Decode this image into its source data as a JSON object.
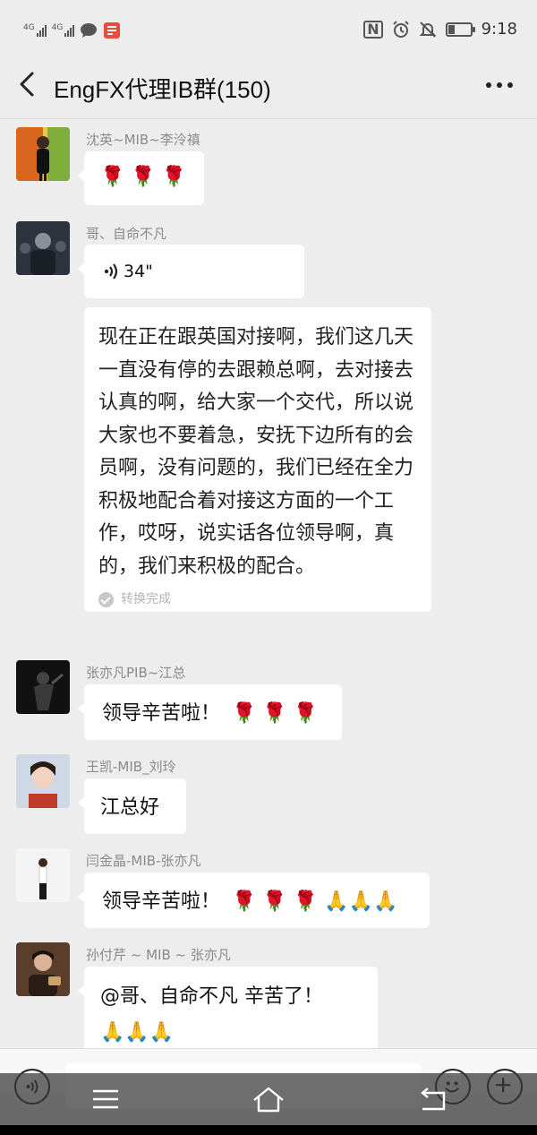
{
  "status_bar": {
    "sim1_tag": "4G",
    "sim2_tag": "4G",
    "time": "9:18",
    "nfc": "N",
    "battery_level": 0.3
  },
  "header": {
    "title": "EngFX代理IB群(150)",
    "back_icon": "chevron-left-icon",
    "more_icon": "more-dots-icon"
  },
  "messages": [
    {
      "sender": "沈英~MIB~李泠禛",
      "content": "🌹 🌹 🌹",
      "type": "emoji"
    },
    {
      "sender": "哥、自命不凡",
      "voice_duration": "34\"",
      "transcript": "现在正在跟英国对接啊，我们这几天一直没有停的去跟赖总啊，去对接去认真的啊，给大家一个交代，所以说大家也不要着急，安抚下边所有的会员啊，没有问题的，我们已经在全力积极地配合着对接这方面的一个工作，哎呀，说实话各位领导啊，真的，我们来积极的配合。",
      "transcript_status": "转换完成",
      "type": "voice"
    },
    {
      "sender": "张亦凡PIB~江总",
      "text": "领导辛苦啦！",
      "emoji": "🌹 🌹 🌹",
      "type": "text"
    },
    {
      "sender": "王凯-MIB_刘玲",
      "text": "江总好",
      "type": "text"
    },
    {
      "sender": "闫金晶-MIB-张亦凡",
      "text": "领导辛苦啦！",
      "emoji": "🌹 🌹 🌹",
      "emoji2": "🙏🙏🙏",
      "type": "text"
    },
    {
      "sender": "孙付芹 ~ MIB ~ 张亦凡",
      "text": "@哥、自命不凡  辛苦了！",
      "emoji": "🙏🙏🙏",
      "type": "text"
    }
  ],
  "input_bar": {
    "value": "",
    "voice_icon": "voice-input-icon",
    "emoji_icon": "emoji-icon",
    "plus_icon": "plus-icon"
  },
  "nav_bar": {
    "menu_icon": "menu-icon",
    "home_icon": "home-icon",
    "back_icon": "back-icon"
  },
  "colors": {
    "background": "#ededed",
    "bubble": "#ffffff",
    "sender": "#8a8a8a",
    "rose": "#d41e2b"
  }
}
